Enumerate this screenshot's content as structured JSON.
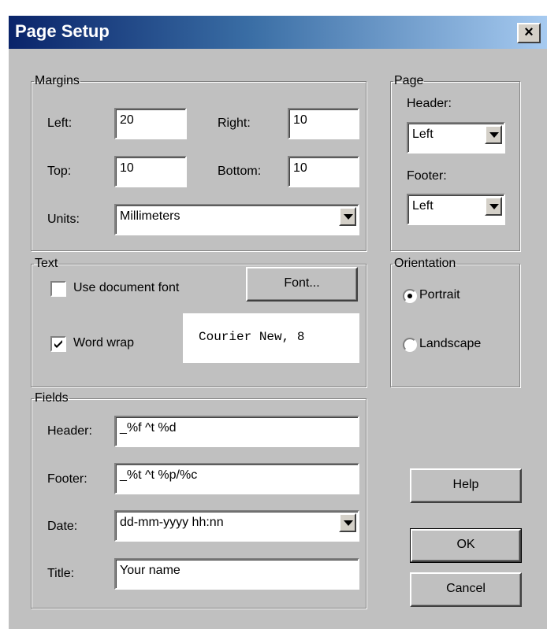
{
  "window": {
    "title": "Page Setup",
    "close_label": "×"
  },
  "margins": {
    "legend": "Margins",
    "left_label": "Left:",
    "left_value": "20",
    "right_label": "Right:",
    "right_value": "10",
    "top_label": "Top:",
    "top_value": "10",
    "bottom_label": "Bottom:",
    "bottom_value": "10",
    "units_label": "Units:",
    "units_value": "Millimeters"
  },
  "page": {
    "legend": "Page",
    "header_label": "Header:",
    "header_value": "Left",
    "footer_label": "Footer:",
    "footer_value": "Left"
  },
  "text": {
    "legend": "Text",
    "use_doc_font_label": "Use document font",
    "use_doc_font_checked": false,
    "word_wrap_label": "Word wrap",
    "word_wrap_checked": true,
    "font_button": "Font...",
    "font_preview": "Courier New, 8"
  },
  "orientation": {
    "legend": "Orientation",
    "portrait_label": "Portrait",
    "landscape_label": "Landscape",
    "selected": "Portrait"
  },
  "fields": {
    "legend": "Fields",
    "header_label": "Header:",
    "header_value": "_%f ^t %d",
    "footer_label": "Footer:",
    "footer_value": "_%t ^t %p/%c",
    "date_label": "Date:",
    "date_value": "dd-mm-yyyy hh:nn",
    "title_label": "Title:",
    "title_value": "Your name"
  },
  "buttons": {
    "help": "Help",
    "ok": "OK",
    "cancel": "Cancel"
  }
}
